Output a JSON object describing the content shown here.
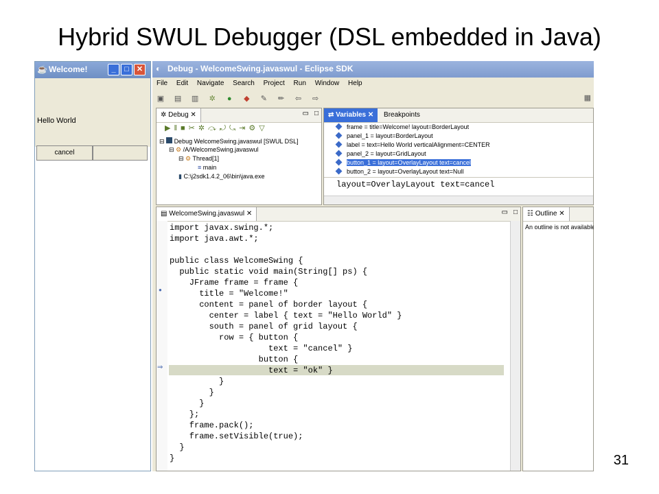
{
  "slide": {
    "title": "Hybrid SWUL Debugger (DSL embedded in Java)",
    "page_number": "31"
  },
  "welcome_window": {
    "title": "Welcome!",
    "label": "Hello World",
    "cancel_label": "cancel"
  },
  "eclipse": {
    "title": "Debug - WelcomeSwing.javaswul - Eclipse SDK",
    "menu": [
      "File",
      "Edit",
      "Navigate",
      "Search",
      "Project",
      "Run",
      "Window",
      "Help"
    ],
    "debug_view": {
      "tab": "Debug",
      "tree": [
        "Debug WelcomeSwing.javaswul [SWUL DSL]",
        "/A/WelcomeSwing.javaswul",
        "Thread[1]",
        "main",
        "C:\\j2sdk1.4.2_06\\bin\\java.exe"
      ]
    },
    "variables_view": {
      "tabs": [
        "Variables",
        "Breakpoints"
      ],
      "rows": [
        "frame =  title=Welcome! layout=BorderLayout",
        "panel_1 =   layout=BorderLayout",
        "label =    text=Hello World verticalAlignment=CENTER",
        "panel_2 =   layout=GridLayout",
        "button_1 =   layout=OverlayLayout text=cancel",
        "button_2 =   layout=OverlayLayout text=Null"
      ],
      "detail": "layout=OverlayLayout text=cancel"
    },
    "editor": {
      "tab": "WelcomeSwing.javaswul",
      "code": [
        "import javax.swing.*;",
        "import java.awt.*;",
        "",
        "public class WelcomeSwing {",
        "  public static void main(String[] ps) {",
        "    JFrame frame = frame {",
        "      title = \"Welcome!\"",
        "      content = panel of border layout {",
        "        center = label { text = \"Hello World\" }",
        "        south = panel of grid layout {",
        "          row = { button {",
        "                    text = \"cancel\" }",
        "                  button {",
        "                    text = \"ok\" }",
        "          }",
        "        }",
        "      }",
        "    };",
        "    frame.pack();",
        "    frame.setVisible(true);",
        "  }",
        "}"
      ]
    },
    "outline_view": {
      "tab": "Outline",
      "message": "An outline is not available."
    }
  }
}
